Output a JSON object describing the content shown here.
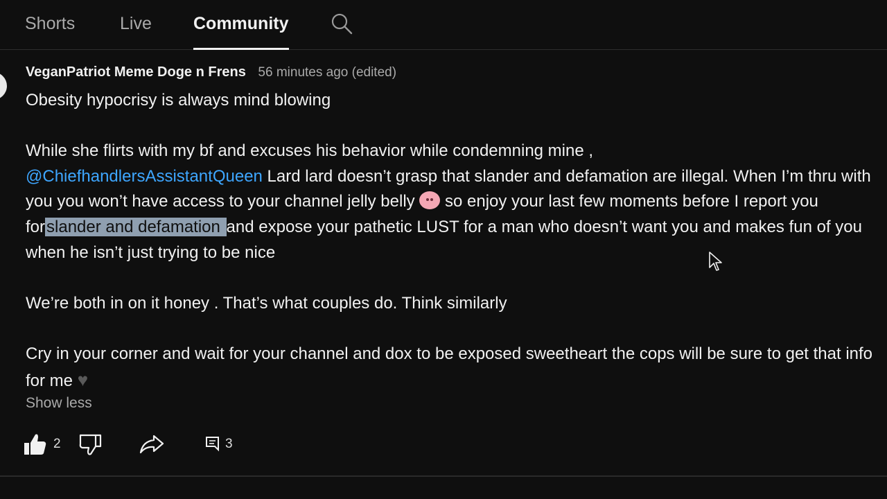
{
  "tabs": [
    {
      "label": "Shorts"
    },
    {
      "label": "Live"
    },
    {
      "label": "Community"
    }
  ],
  "post": {
    "author": "VeganPatriot Meme Doge n Frens",
    "timestamp": "56 minutes ago (edited)",
    "line1": "Obesity hypocrisy is always mind blowing",
    "p2_part1": "While she flirts with my bf and excuses his behavior while condemning mine ,",
    "mention": "@ChiefhandlersAssistantQueen",
    "p2_part2": " Lard lard doesn’t grasp that slander and defamation are illegal. When I’m thru with you you won’t have access to your channel jelly belly ",
    "p2_part3": " so enjoy your last few moments before I report you for",
    "p2_highlight": "slander and defamation ",
    "p2_part4": "and expose your pathetic LUST for a man who doesn’t want you and makes fun of you when he isn’t just trying to be nice",
    "p3": "We’re both in on it honey . That’s what couples do. Think similarly",
    "p4": " Cry in your corner and wait for your channel and dox to be exposed sweetheart the cops will be sure to get that info for me ",
    "show_less": "Show less",
    "like_count": "2",
    "comment_count": "3",
    "emoji_pig": "pig-face-emoji",
    "emoji_heart": "black-heart-emoji"
  },
  "colors": {
    "background": "#0f0f0f",
    "text": "#f1f1f1",
    "muted": "#aaaaaa",
    "mention": "#3ea6ff",
    "highlight": "#8f9fb0"
  },
  "icons": [
    "search-icon",
    "like-icon",
    "dislike-icon",
    "share-icon",
    "comment-icon",
    "mouse-cursor-icon"
  ]
}
